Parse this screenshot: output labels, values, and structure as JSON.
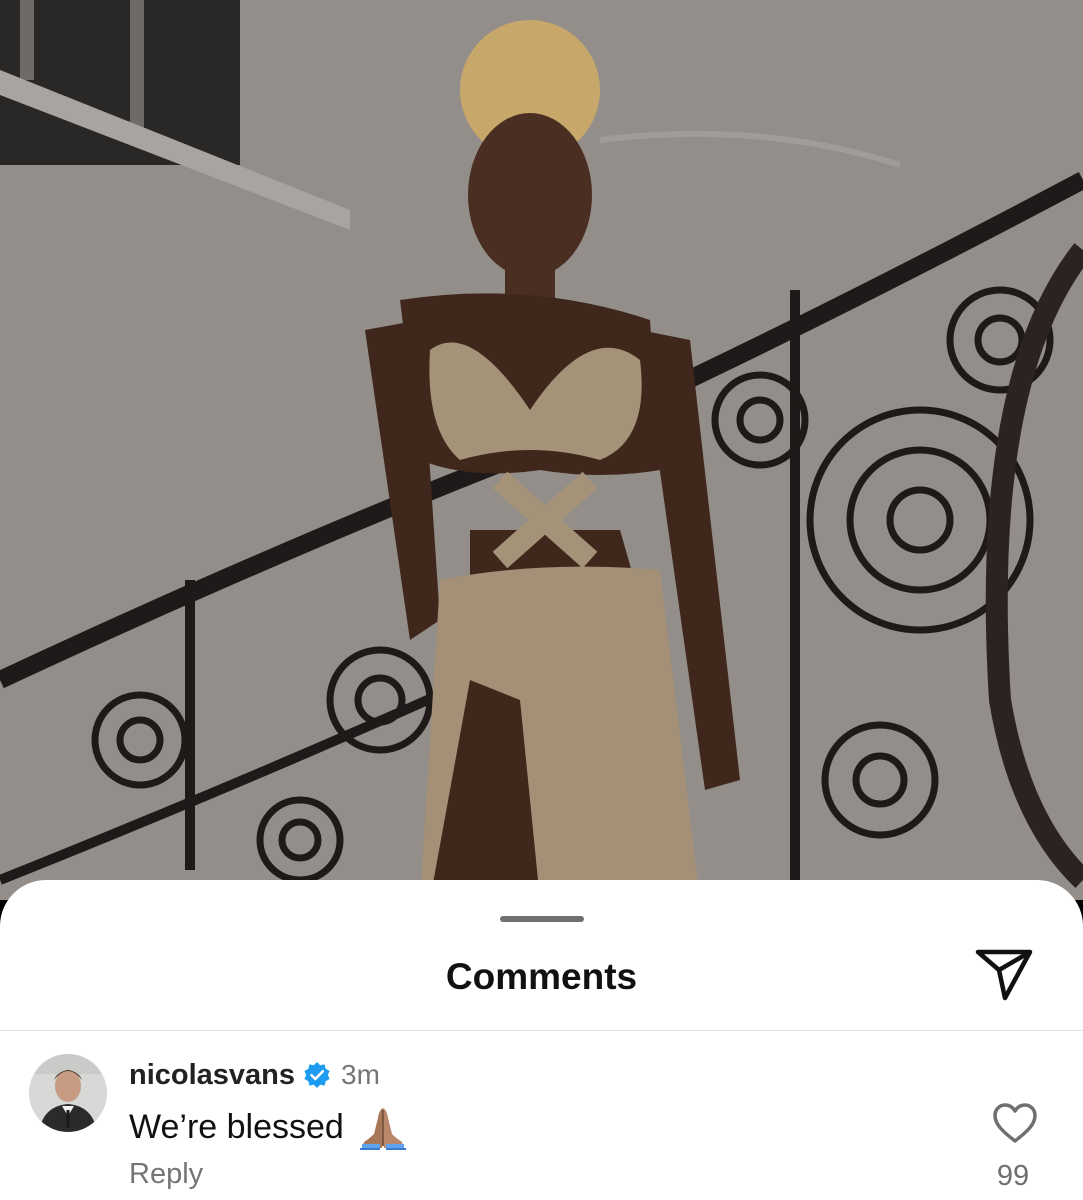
{
  "sheet": {
    "title": "Comments"
  },
  "comment": {
    "username": "nicolasvans",
    "verified": true,
    "time": "3m",
    "text": "We’re blessed",
    "emoji": "folded-hands-emoji",
    "reply_label": "Reply",
    "like_count": "99"
  },
  "icons": {
    "share": "paper-plane-icon",
    "like": "heart-outline-icon",
    "verified": "verified-badge-icon"
  },
  "colors": {
    "verified_blue": "#1d9bf0",
    "secondary_text": "#767676"
  }
}
